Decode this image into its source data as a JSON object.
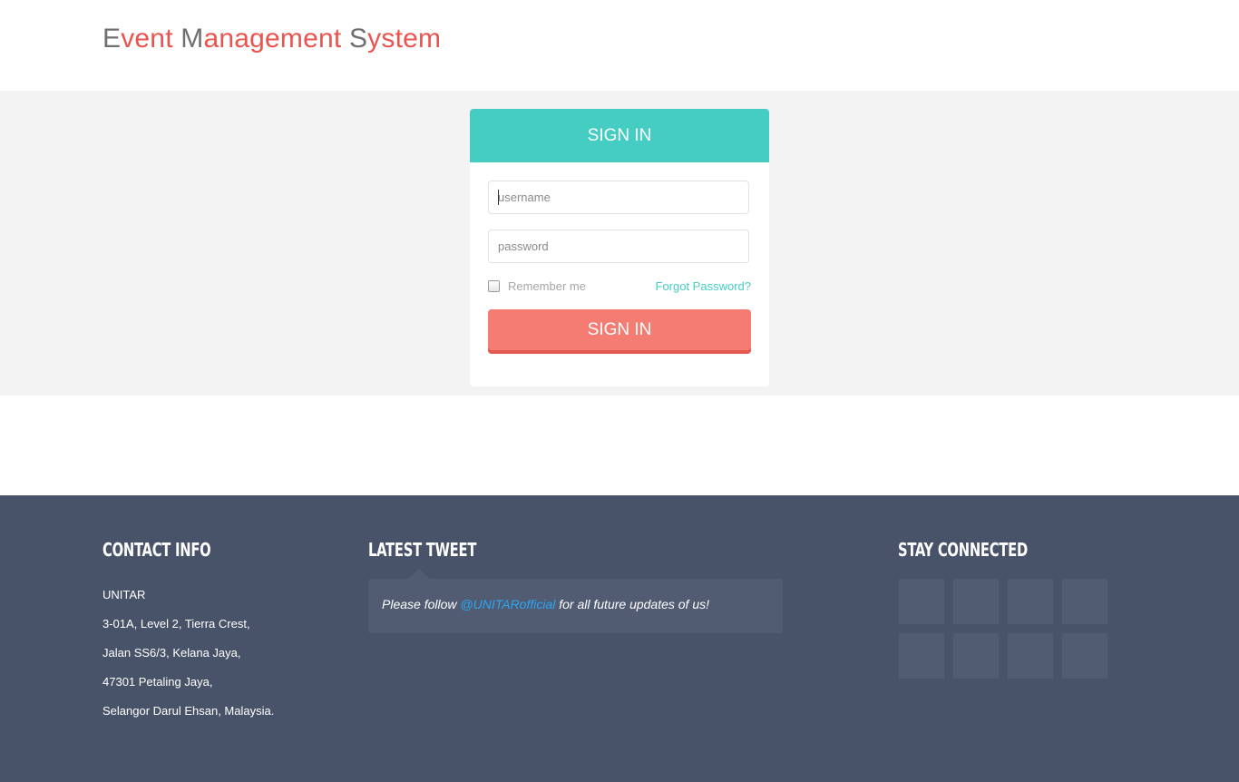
{
  "header": {
    "brand_parts": [
      {
        "cap": "E",
        "rest": "vent"
      },
      {
        "cap": "M",
        "rest": "anagement"
      },
      {
        "cap": "S",
        "rest": "ystem"
      }
    ]
  },
  "login": {
    "heading": "SIGN IN",
    "username_placeholder": "username",
    "password_placeholder": "password",
    "remember_label": "Remember me",
    "forgot_label": "Forgot Password?",
    "submit_label": "SIGN IN"
  },
  "footer": {
    "contact_title": "CONTACT INFO",
    "contact_lines": [
      "UNITAR",
      "3-01A, Level 2, Tierra Crest,",
      "Jalan SS6/3, Kelana Jaya,",
      "47301 Petaling Jaya,",
      "Selangor Darul Ehsan, Malaysia."
    ],
    "tweet_title": "LATEST TWEET",
    "tweet_before": "Please follow ",
    "tweet_handle": "@UNITARofficial",
    "tweet_after": " for all future updates of us!",
    "stay_title": "STAY CONNECTED"
  },
  "colors": {
    "accent_teal": "#45ccc3",
    "accent_coral": "#f47c72",
    "footer_bg": "#485369",
    "brand_red": "#e9544f"
  }
}
